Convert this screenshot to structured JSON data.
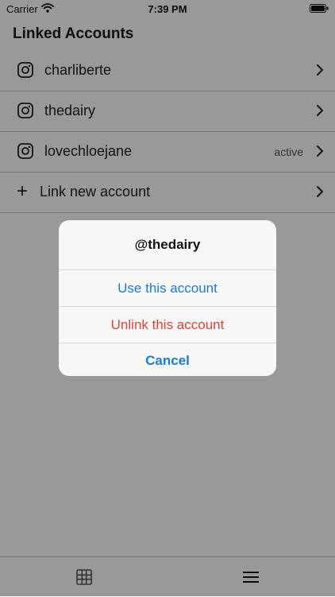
{
  "status_bar": {
    "carrier": "Carrier",
    "time": "7:39 PM"
  },
  "header": {
    "title": "Linked Accounts"
  },
  "accounts": [
    {
      "name": "charliberte",
      "badge": ""
    },
    {
      "name": "thedairy",
      "badge": ""
    },
    {
      "name": "lovechloejane",
      "badge": "active"
    }
  ],
  "link_new": {
    "icon": "+",
    "label": "Link new account"
  },
  "alert": {
    "title": "@thedairy",
    "use_label": "Use this account",
    "unlink_label": "Unlink this account",
    "cancel_label": "Cancel"
  },
  "colors": {
    "accent": "#1b7ad1",
    "destructive": "#e0413b"
  },
  "icons": {
    "account": "instagram-icon",
    "row_disclosure": "chevron-right-icon",
    "tab_left": "grid-icon",
    "tab_right": "menu-icon"
  }
}
